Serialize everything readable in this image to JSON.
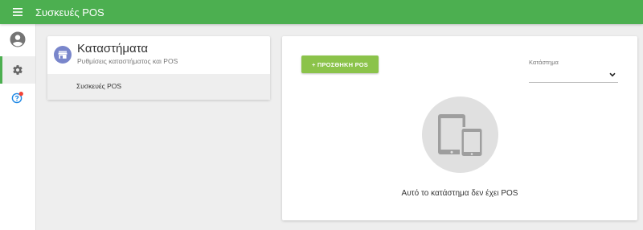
{
  "app": {
    "title": "Συσκευές POS",
    "accent_color": "#4caf50"
  },
  "rail": {
    "items": [
      {
        "icon": "account-circle-icon",
        "active": false
      },
      {
        "icon": "gear-icon",
        "active": true
      },
      {
        "icon": "help-icon",
        "active": false,
        "badge_color": "#f44336"
      }
    ]
  },
  "stores_card": {
    "title": "Καταστήματα",
    "subtitle": "Ρυθμίσεις καταστήματος και POS",
    "icon": "store-icon",
    "items": [
      {
        "label": "Συσκευές POS",
        "selected": true
      }
    ]
  },
  "main": {
    "add_button_label": "+ ΠΡΟΣΘΗΚΗ POS",
    "add_button_color": "#8bc34a",
    "store_select": {
      "label": "Κατάστημα",
      "value": ""
    },
    "empty_state": {
      "icon": "devices-icon",
      "message": "Αυτό το κατάστημα δεν έχει POS"
    }
  }
}
